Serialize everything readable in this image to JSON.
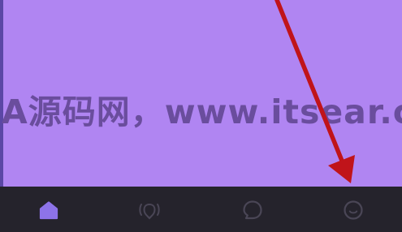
{
  "watermark": {
    "text": "A源码网，www.itsear.co"
  },
  "colors": {
    "content_bg": "#b085f2",
    "tabbar_bg": "#25232c",
    "active_icon": "#8d73e8",
    "inactive_icon": "#4a4656",
    "arrow": "#c0141a"
  },
  "tabbar": {
    "tabs": [
      {
        "icon": "home-icon",
        "active": true
      },
      {
        "icon": "broadcast-icon",
        "active": false
      },
      {
        "icon": "chat-bubble-icon",
        "active": false
      },
      {
        "icon": "face-icon",
        "active": false
      }
    ]
  },
  "annotation": {
    "icon": "red-arrow",
    "points_to": "face-icon"
  }
}
